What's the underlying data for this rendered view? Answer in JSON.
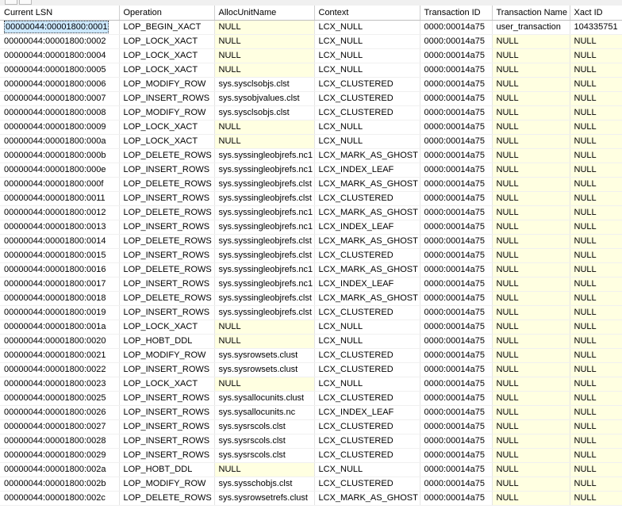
{
  "columns": [
    "Current LSN",
    "Operation",
    "AllocUnitName",
    "Context",
    "Transaction ID",
    "Transaction Name",
    "Xact ID"
  ],
  "rows": [
    [
      "00000044:00001800:0001",
      "LOP_BEGIN_XACT",
      "NULL",
      "LCX_NULL",
      "0000:00014a75",
      "user_transaction",
      "104335751"
    ],
    [
      "00000044:00001800:0002",
      "LOP_LOCK_XACT",
      "NULL",
      "LCX_NULL",
      "0000:00014a75",
      "NULL",
      "NULL"
    ],
    [
      "00000044:00001800:0004",
      "LOP_LOCK_XACT",
      "NULL",
      "LCX_NULL",
      "0000:00014a75",
      "NULL",
      "NULL"
    ],
    [
      "00000044:00001800:0005",
      "LOP_LOCK_XACT",
      "NULL",
      "LCX_NULL",
      "0000:00014a75",
      "NULL",
      "NULL"
    ],
    [
      "00000044:00001800:0006",
      "LOP_MODIFY_ROW",
      "sys.sysclsobjs.clst",
      "LCX_CLUSTERED",
      "0000:00014a75",
      "NULL",
      "NULL"
    ],
    [
      "00000044:00001800:0007",
      "LOP_INSERT_ROWS",
      "sys.sysobjvalues.clst",
      "LCX_CLUSTERED",
      "0000:00014a75",
      "NULL",
      "NULL"
    ],
    [
      "00000044:00001800:0008",
      "LOP_MODIFY_ROW",
      "sys.sysclsobjs.clst",
      "LCX_CLUSTERED",
      "0000:00014a75",
      "NULL",
      "NULL"
    ],
    [
      "00000044:00001800:0009",
      "LOP_LOCK_XACT",
      "NULL",
      "LCX_NULL",
      "0000:00014a75",
      "NULL",
      "NULL"
    ],
    [
      "00000044:00001800:000a",
      "LOP_LOCK_XACT",
      "NULL",
      "LCX_NULL",
      "0000:00014a75",
      "NULL",
      "NULL"
    ],
    [
      "00000044:00001800:000b",
      "LOP_DELETE_ROWS",
      "sys.syssingleobjrefs.nc1",
      "LCX_MARK_AS_GHOST",
      "0000:00014a75",
      "NULL",
      "NULL"
    ],
    [
      "00000044:00001800:000e",
      "LOP_INSERT_ROWS",
      "sys.syssingleobjrefs.nc1",
      "LCX_INDEX_LEAF",
      "0000:00014a75",
      "NULL",
      "NULL"
    ],
    [
      "00000044:00001800:000f",
      "LOP_DELETE_ROWS",
      "sys.syssingleobjrefs.clst",
      "LCX_MARK_AS_GHOST",
      "0000:00014a75",
      "NULL",
      "NULL"
    ],
    [
      "00000044:00001800:0011",
      "LOP_INSERT_ROWS",
      "sys.syssingleobjrefs.clst",
      "LCX_CLUSTERED",
      "0000:00014a75",
      "NULL",
      "NULL"
    ],
    [
      "00000044:00001800:0012",
      "LOP_DELETE_ROWS",
      "sys.syssingleobjrefs.nc1",
      "LCX_MARK_AS_GHOST",
      "0000:00014a75",
      "NULL",
      "NULL"
    ],
    [
      "00000044:00001800:0013",
      "LOP_INSERT_ROWS",
      "sys.syssingleobjrefs.nc1",
      "LCX_INDEX_LEAF",
      "0000:00014a75",
      "NULL",
      "NULL"
    ],
    [
      "00000044:00001800:0014",
      "LOP_DELETE_ROWS",
      "sys.syssingleobjrefs.clst",
      "LCX_MARK_AS_GHOST",
      "0000:00014a75",
      "NULL",
      "NULL"
    ],
    [
      "00000044:00001800:0015",
      "LOP_INSERT_ROWS",
      "sys.syssingleobjrefs.clst",
      "LCX_CLUSTERED",
      "0000:00014a75",
      "NULL",
      "NULL"
    ],
    [
      "00000044:00001800:0016",
      "LOP_DELETE_ROWS",
      "sys.syssingleobjrefs.nc1",
      "LCX_MARK_AS_GHOST",
      "0000:00014a75",
      "NULL",
      "NULL"
    ],
    [
      "00000044:00001800:0017",
      "LOP_INSERT_ROWS",
      "sys.syssingleobjrefs.nc1",
      "LCX_INDEX_LEAF",
      "0000:00014a75",
      "NULL",
      "NULL"
    ],
    [
      "00000044:00001800:0018",
      "LOP_DELETE_ROWS",
      "sys.syssingleobjrefs.clst",
      "LCX_MARK_AS_GHOST",
      "0000:00014a75",
      "NULL",
      "NULL"
    ],
    [
      "00000044:00001800:0019",
      "LOP_INSERT_ROWS",
      "sys.syssingleobjrefs.clst",
      "LCX_CLUSTERED",
      "0000:00014a75",
      "NULL",
      "NULL"
    ],
    [
      "00000044:00001800:001a",
      "LOP_LOCK_XACT",
      "NULL",
      "LCX_NULL",
      "0000:00014a75",
      "NULL",
      "NULL"
    ],
    [
      "00000044:00001800:0020",
      "LOP_HOBT_DDL",
      "NULL",
      "LCX_NULL",
      "0000:00014a75",
      "NULL",
      "NULL"
    ],
    [
      "00000044:00001800:0021",
      "LOP_MODIFY_ROW",
      "sys.sysrowsets.clust",
      "LCX_CLUSTERED",
      "0000:00014a75",
      "NULL",
      "NULL"
    ],
    [
      "00000044:00001800:0022",
      "LOP_INSERT_ROWS",
      "sys.sysrowsets.clust",
      "LCX_CLUSTERED",
      "0000:00014a75",
      "NULL",
      "NULL"
    ],
    [
      "00000044:00001800:0023",
      "LOP_LOCK_XACT",
      "NULL",
      "LCX_NULL",
      "0000:00014a75",
      "NULL",
      "NULL"
    ],
    [
      "00000044:00001800:0025",
      "LOP_INSERT_ROWS",
      "sys.sysallocunits.clust",
      "LCX_CLUSTERED",
      "0000:00014a75",
      "NULL",
      "NULL"
    ],
    [
      "00000044:00001800:0026",
      "LOP_INSERT_ROWS",
      "sys.sysallocunits.nc",
      "LCX_INDEX_LEAF",
      "0000:00014a75",
      "NULL",
      "NULL"
    ],
    [
      "00000044:00001800:0027",
      "LOP_INSERT_ROWS",
      "sys.sysrscols.clst",
      "LCX_CLUSTERED",
      "0000:00014a75",
      "NULL",
      "NULL"
    ],
    [
      "00000044:00001800:0028",
      "LOP_INSERT_ROWS",
      "sys.sysrscols.clst",
      "LCX_CLUSTERED",
      "0000:00014a75",
      "NULL",
      "NULL"
    ],
    [
      "00000044:00001800:0029",
      "LOP_INSERT_ROWS",
      "sys.sysrscols.clst",
      "LCX_CLUSTERED",
      "0000:00014a75",
      "NULL",
      "NULL"
    ],
    [
      "00000044:00001800:002a",
      "LOP_HOBT_DDL",
      "NULL",
      "LCX_NULL",
      "0000:00014a75",
      "NULL",
      "NULL"
    ],
    [
      "00000044:00001800:002b",
      "LOP_MODIFY_ROW",
      "sys.sysschobjs.clst",
      "LCX_CLUSTERED",
      "0000:00014a75",
      "NULL",
      "NULL"
    ],
    [
      "00000044:00001800:002c",
      "LOP_DELETE_ROWS",
      "sys.sysrowsetrefs.clust",
      "LCX_MARK_AS_GHOST",
      "0000:00014a75",
      "NULL",
      "NULL"
    ]
  ],
  "colors": {
    "null_cell_bg": "#ffffe1",
    "selection_bg": "#cce8ff",
    "grid_line": "#e4e4e4"
  }
}
